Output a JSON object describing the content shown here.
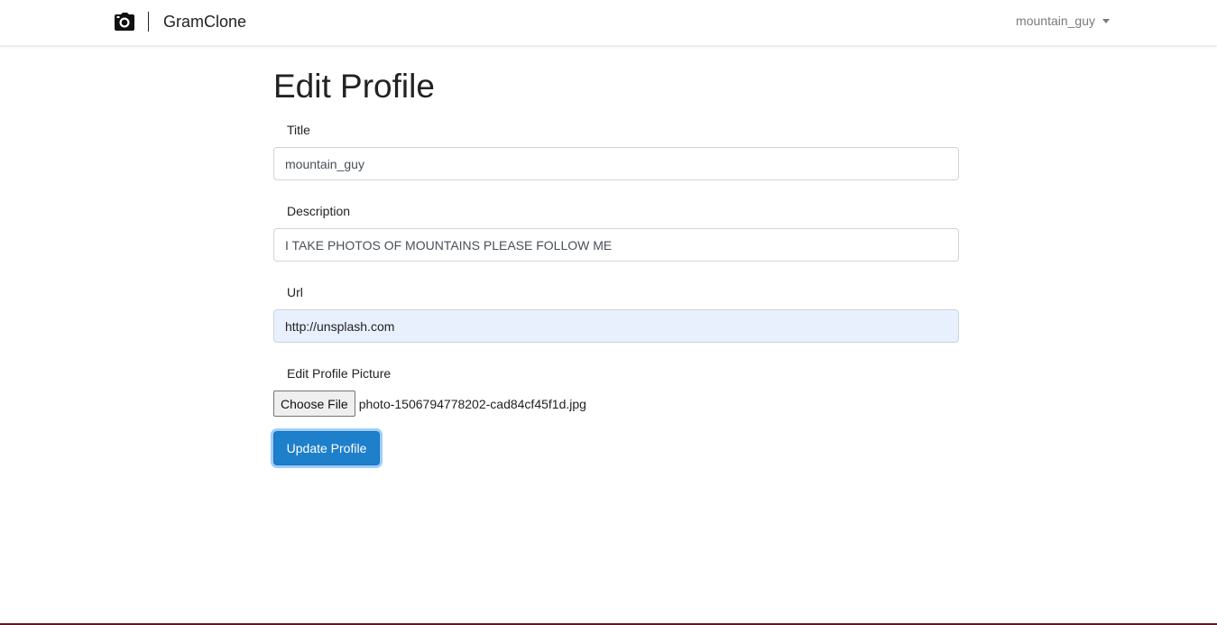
{
  "navbar": {
    "brand_icon": "camera-icon",
    "brand_name": "GramClone",
    "user_name": "mountain_guy",
    "user_menu_icon": "caret-down-icon"
  },
  "form": {
    "heading": "Edit Profile",
    "title_label": "Title",
    "title_value": "mountain_guy",
    "description_label": "Description",
    "description_value": "I TAKE PHOTOS OF MOUNTAINS PLEASE FOLLOW ME",
    "url_label": "Url",
    "url_value": "http://unsplash.com",
    "picture_label": "Edit Profile Picture",
    "choose_file_label": "Choose File",
    "file_name": "photo-1506794778202-cad84cf45f1d.jpg",
    "submit_label": "Update Profile"
  },
  "colors": {
    "primary_button": "#1e7fcb",
    "autofill_background": "#e8f0fe",
    "bottom_bar": "#5a1a1f"
  }
}
